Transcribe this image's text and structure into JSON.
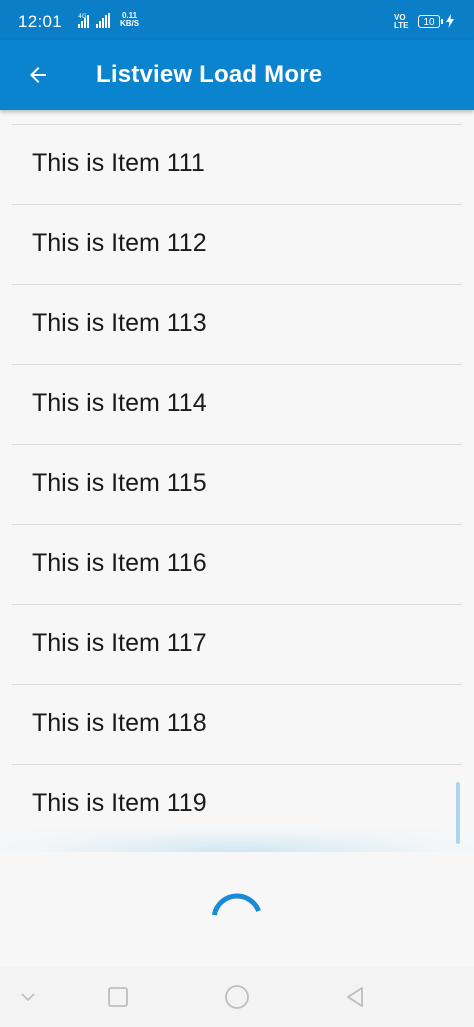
{
  "status": {
    "time": "12:01",
    "network_label": "4G",
    "speed_value": "0.11",
    "speed_unit": "KB/S",
    "volte_top": "VO",
    "volte_bottom": "LTE",
    "battery": "10"
  },
  "appbar": {
    "title": "Listview Load More",
    "back_icon": "arrow-left-icon"
  },
  "list": {
    "items": [
      {
        "label": "This is Item 111"
      },
      {
        "label": "This is Item 112"
      },
      {
        "label": "This is Item 113"
      },
      {
        "label": "This is Item 114"
      },
      {
        "label": "This is Item 115"
      },
      {
        "label": "This is Item 116"
      },
      {
        "label": "This is Item 117"
      },
      {
        "label": "This is Item 118"
      },
      {
        "label": "This is Item 119"
      }
    ]
  },
  "colors": {
    "primary": "#0a84ce",
    "status_bar": "#0a7fc7",
    "spinner": "#1a8ad4",
    "divider": "#dcdcdc"
  },
  "nav": {
    "icons": [
      "chevron-down-icon",
      "square-icon",
      "circle-icon",
      "triangle-back-icon"
    ]
  }
}
